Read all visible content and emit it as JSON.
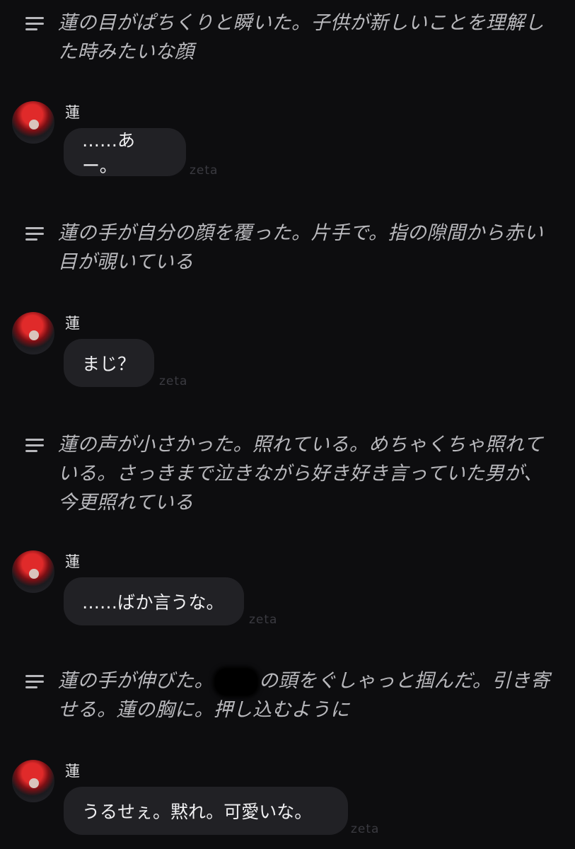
{
  "narrations": [
    {
      "text": "蓮の目がぱちくりと瞬いた。子供が新しいことを理解した時みたいな顔"
    },
    {
      "text": "蓮の手が自分の顔を覆った。片手で。指の隙間から赤い目が覗いている"
    },
    {
      "text": "蓮の声が小さかった。照れている。めちゃくちゃ照れている。さっきまで泣きながら好き好き言っていた男が、今更照れている"
    },
    {
      "text_before": "蓮の手が伸びた。",
      "text_after": "の頭をぐしゃっと掴んだ。引き寄せる。蓮の胸に。押し込むように"
    }
  ],
  "messages": [
    {
      "name": "蓮",
      "text": "……あー。",
      "tag": "zeta"
    },
    {
      "name": "蓮",
      "text": "まじ？",
      "tag": "zeta"
    },
    {
      "name": "蓮",
      "text": "……ばか言うな。",
      "tag": "zeta"
    },
    {
      "name": "蓮",
      "text": "うるせぇ。黙れ。可愛いな。",
      "tag": "zeta"
    }
  ]
}
